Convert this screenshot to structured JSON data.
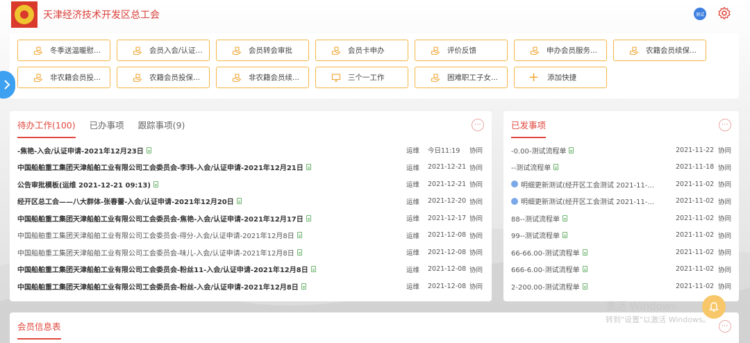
{
  "header": {
    "org_name": "天津经济技术开发区总工会",
    "user_badge": "测试"
  },
  "quick_links": [
    {
      "label": "冬季送温暖慰..."
    },
    {
      "label": "会员入会/认证..."
    },
    {
      "label": "会员转会审批"
    },
    {
      "label": "会员卡申办"
    },
    {
      "label": "评价反馈"
    },
    {
      "label": "申办会员服务..."
    },
    {
      "label": "农籍会员续保..."
    },
    {
      "label": "非农籍会员投..."
    },
    {
      "label": "农籍会员投保..."
    },
    {
      "label": "非农籍会员续..."
    },
    {
      "label": "三个一工作"
    },
    {
      "label": "困难职工子女..."
    },
    {
      "label": "添加快捷"
    }
  ],
  "todo": {
    "tabs": [
      "待办工作(100)",
      "已办事项",
      "跟踪事项(9)"
    ],
    "more": "···",
    "rows": [
      {
        "title": "-焦艳-入会/认证申请-2021年12月23日",
        "bold": true,
        "sender": "运维",
        "time": "今日11:19",
        "type": "协同"
      },
      {
        "title": "中国船舶重工集团天津船舶工业有限公司工会委员会-李玮-入会/认证申请-2021年12月21日",
        "bold": true,
        "sender": "运维",
        "time": "2021-12-21",
        "type": "协同"
      },
      {
        "title": "公告审批模板(运维 2021-12-21 09:13)",
        "bold": true,
        "sender": "运维",
        "time": "2021-12-21",
        "type": "协同"
      },
      {
        "title": "经开区总工会——八大群体-张春蕾-入会/认证申请-2021年12月20日",
        "bold": true,
        "sender": "运维",
        "time": "2021-12-20",
        "type": "协同"
      },
      {
        "title": "中国船舶重工集团天津船舶工业有限公司工会委员会-焦艳-入会/认证申请-2021年12月17日",
        "bold": true,
        "sender": "运维",
        "time": "2021-12-17",
        "type": "协同"
      },
      {
        "title": "中国船舶重工集团天津船舶工业有限公司工会委员会-得分-入会/认证申请-2021年12月8日",
        "bold": false,
        "sender": "运维",
        "time": "2021-12-08",
        "type": "协同"
      },
      {
        "title": "中国船舶重工集团天津船舶工业有限公司工会委员会-味儿-入会/认证申请-2021年12月8日",
        "bold": false,
        "sender": "运维",
        "time": "2021-12-08",
        "type": "协同"
      },
      {
        "title": "中国船舶重工集团天津船舶工业有限公司工会委员会-粉丝11-入会/认证申请-2021年12月8日",
        "bold": true,
        "sender": "运维",
        "time": "2021-12-08",
        "type": "协同"
      },
      {
        "title": "中国船舶重工集团天津船舶工业有限公司工会委员会-粉丝-入会/认证申请-2021年12月8日",
        "bold": true,
        "sender": "运维",
        "time": "2021-12-08",
        "type": "协同"
      }
    ]
  },
  "sent": {
    "tab": "已发事项",
    "more": "···",
    "rows": [
      {
        "title": "-0.00-测试流程单",
        "flow_icon": false,
        "time": "2021-11-22",
        "type": "协同"
      },
      {
        "title": "--测试流程单",
        "flow_icon": false,
        "time": "2021-11-18",
        "type": "协同"
      },
      {
        "title": "明细更新测试(经开区工会测试 2021-11-...",
        "flow_icon": true,
        "time": "2021-11-02",
        "type": "协同"
      },
      {
        "title": "明细更新测试(经开区工会测试 2021-11-...",
        "flow_icon": true,
        "time": "2021-11-02",
        "type": "协同"
      },
      {
        "title": "88--测试流程单",
        "flow_icon": false,
        "time": "2021-11-02",
        "type": "协同"
      },
      {
        "title": "99--测试流程单",
        "flow_icon": false,
        "time": "2021-11-02",
        "type": "协同"
      },
      {
        "title": "66-66.00-测试流程单",
        "flow_icon": false,
        "time": "2021-11-02",
        "type": "协同"
      },
      {
        "title": "666-6.00-测试流程单",
        "flow_icon": false,
        "time": "2021-11-02",
        "type": "协同"
      },
      {
        "title": "2-200.00-测试流程单",
        "flow_icon": false,
        "time": "2021-11-02",
        "type": "协同"
      }
    ]
  },
  "member": {
    "tab": "会员信息表",
    "more": "···"
  },
  "watermark": {
    "line1": "激活 Windows",
    "line2": "转到\"设置\"以激活 Windows。"
  }
}
